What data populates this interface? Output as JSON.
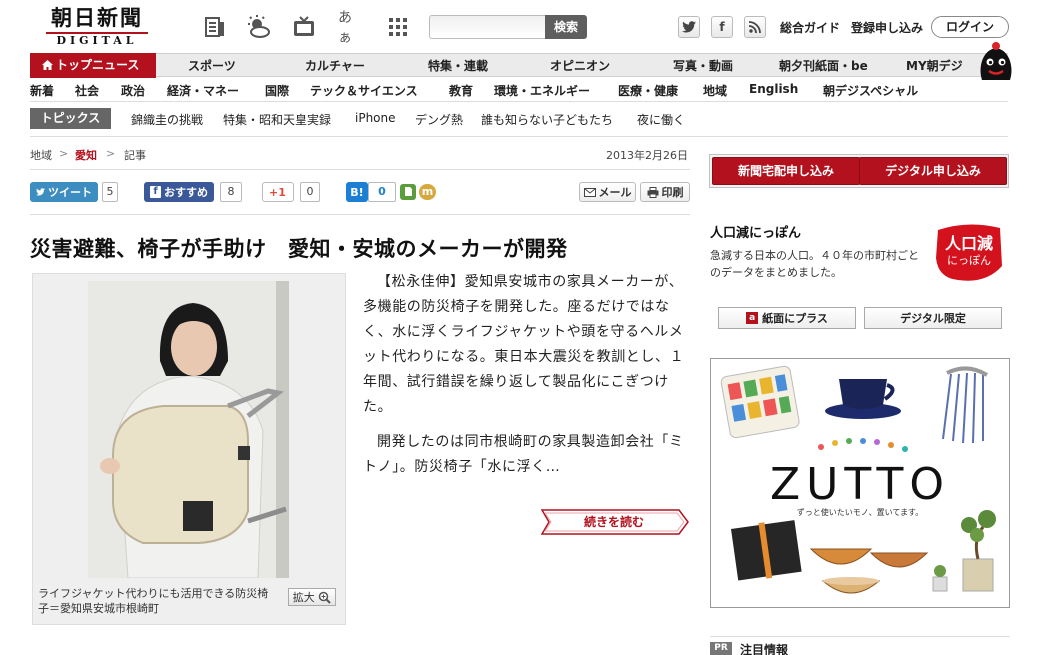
{
  "header": {
    "logo_main": "朝日新聞",
    "logo_sub": "DIGITAL",
    "icon_kana": "あぁ",
    "search_placeholder": "",
    "search_button": "検索",
    "facebook_letter": "f",
    "links": [
      "総合ガイド",
      "登録申し込み"
    ],
    "login": "ログイン"
  },
  "nav": {
    "top_label": "トップニュース",
    "items": [
      "スポーツ",
      "カルチャー",
      "特集・連載",
      "オピニオン",
      "写真・動画",
      "朝夕刊紙面・be",
      "MY朝デジ"
    ]
  },
  "subnav": {
    "items": [
      "新着",
      "社会",
      "政治",
      "経済・マネー",
      "国際",
      "テック＆サイエンス",
      "教育",
      "環境・エネルギー",
      "医療・健康",
      "地域",
      "English",
      "朝デジスペシャル"
    ]
  },
  "topics": {
    "label": "トピックス",
    "items": [
      "錦織圭の挑戦",
      "特集・昭和天皇実録",
      "iPhone",
      "デング熱",
      "誰も知らない子どもたち",
      "夜に働く"
    ]
  },
  "breadcrumb": {
    "items": [
      "地域",
      "愛知",
      "記事"
    ],
    "separator": ">",
    "date": "2013年2月26日"
  },
  "share": {
    "tweet": "ツイート",
    "tweet_count": "5",
    "fb": "おすすめ",
    "fb_count": "8",
    "gplus": "+1",
    "gplus_count": "0",
    "hatena": "B!",
    "hatena_count": "0",
    "mixi_letter": "m",
    "mail": "メール",
    "print": "印刷"
  },
  "article": {
    "headline": "災害避難、椅子が手助け　愛知・安城のメーカーが開発",
    "caption": "ライフジャケット代わりにも活用できる防災椅子＝愛知県安城市根崎町",
    "zoom": "拡大",
    "para1": "【松永佳伸】愛知県安城市の家具メーカーが、多機能の防災椅子を開発した。座るだけではなく、水に浮くライフジャケットや頭を守るヘルメット代わりになる。東日本大震災を教訓とし、１年間、試行錯誤を繰り返して製品化にこぎつけた。",
    "para2": "開発したのは同市根崎町の家具製造卸会社「ミトノ」。防災椅子「水に浮く…",
    "read_more": "続きを読む"
  },
  "sidebar": {
    "subscribe_home": "新聞宅配申し込み",
    "subscribe_digital": "デジタル申し込み",
    "pop_title": "人口減にっぽん",
    "pop_desc": "急減する日本の人口。４０年の市町村ごとのデータをまとめました。",
    "pop_badge_1": "人口減",
    "pop_badge_2": "にっぽん",
    "btn_plus": "紙面にプラス",
    "btn_plus_icon_letter": "a",
    "btn_digital": "デジタル限定",
    "ad_brand": "ZUTTO",
    "ad_tagline": "ずっと使いたいモノ、置いてます。",
    "pr_badge": "PR",
    "pr_title": "注目情報"
  },
  "colors": {
    "brand_red": "#b3111d",
    "twitter": "#3d8dc0",
    "facebook": "#3b5998"
  }
}
